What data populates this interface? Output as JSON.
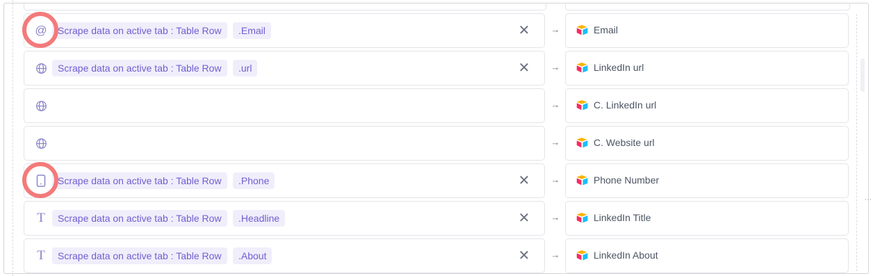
{
  "mappings": [
    {
      "icon": "at-icon",
      "source_label": "Scrape data on active tab : Table Row",
      "field_label": ".Email",
      "has_clear": true,
      "target_label": "Email",
      "highlighted": true
    },
    {
      "icon": "globe-icon",
      "source_label": "Scrape data on active tab : Table Row",
      "field_label": ".url",
      "has_clear": true,
      "target_label": "LinkedIn url",
      "highlighted": false
    },
    {
      "icon": "globe-icon",
      "source_label": "",
      "field_label": "",
      "has_clear": false,
      "target_label": "C. LinkedIn url",
      "highlighted": false
    },
    {
      "icon": "globe-icon",
      "source_label": "",
      "field_label": "",
      "has_clear": false,
      "target_label": "C. Website url",
      "highlighted": false
    },
    {
      "icon": "phone-icon",
      "source_label": "Scrape data on active tab : Table Row",
      "field_label": ".Phone",
      "has_clear": true,
      "target_label": "Phone Number",
      "highlighted": true
    },
    {
      "icon": "text-icon",
      "source_label": "Scrape data on active tab : Table Row",
      "field_label": ".Headline",
      "has_clear": true,
      "target_label": "LinkedIn Title",
      "highlighted": false
    },
    {
      "icon": "text-icon",
      "source_label": "Scrape data on active tab : Table Row",
      "field_label": ".About",
      "has_clear": true,
      "target_label": "LinkedIn About",
      "highlighted": false
    }
  ],
  "glyphs": {
    "clear": "✕",
    "arrow": "→",
    "at": "@",
    "text": "T",
    "more": "⋯"
  },
  "colors": {
    "chip_bg": "#f0eefb",
    "chip_text": "#6f5fd0",
    "field_icon": "#8b86c9",
    "highlight_ring": "#f47a7a",
    "airtable_yellow": "#fcb400",
    "airtable_blue": "#18bfff",
    "airtable_red": "#f82b60"
  }
}
